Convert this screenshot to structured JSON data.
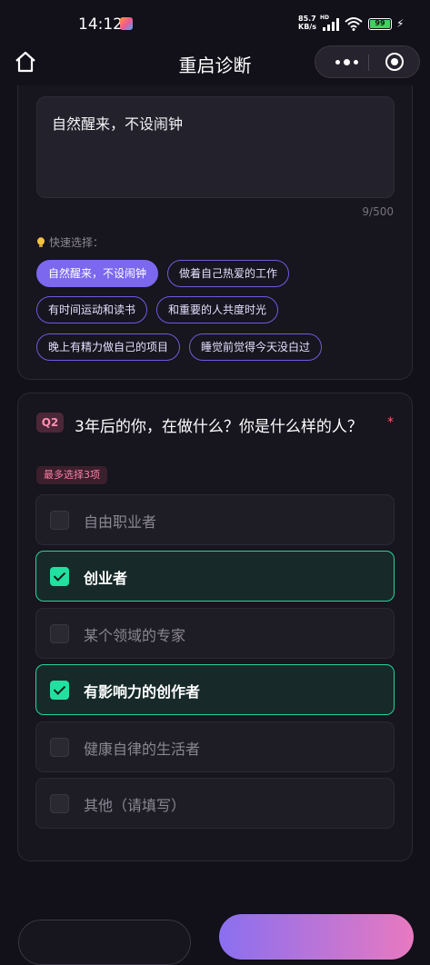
{
  "status_bar": {
    "time": "14:12",
    "net_speed": "85.7",
    "net_unit": "KB/s",
    "hd": "HD",
    "battery": "99",
    "battery_level": 0.99
  },
  "nav": {
    "title": "重启诊断",
    "home_icon": "home-icon",
    "more_icon": "more-dots-icon",
    "close_icon": "close-circle-icon"
  },
  "q1": {
    "answer": "自然醒来，不设闹钟",
    "counter": "9/500",
    "quick_label": "快速选择：",
    "quick_icon": "lightbulb-icon",
    "chips": [
      {
        "label": "自然醒来，不设闹钟",
        "selected": true
      },
      {
        "label": "做着自己热爱的工作",
        "selected": false
      },
      {
        "label": "有时间运动和读书",
        "selected": false
      },
      {
        "label": "和重要的人共度时光",
        "selected": false
      },
      {
        "label": "晚上有精力做自己的项目",
        "selected": false
      },
      {
        "label": "睡觉前觉得今天没白过",
        "selected": false
      }
    ]
  },
  "q2": {
    "badge": "Q2",
    "title": "3年后的你，在做什么？你是什么样的人？",
    "required_mark": "*",
    "limit": "最多选择3项",
    "options": [
      {
        "label": "自由职业者",
        "checked": false
      },
      {
        "label": "创业者",
        "checked": true
      },
      {
        "label": "某个领域的专家",
        "checked": false
      },
      {
        "label": "有影响力的创作者",
        "checked": true
      },
      {
        "label": "健康自律的生活者",
        "checked": false
      },
      {
        "label": "其他（请填写）",
        "checked": false
      }
    ]
  },
  "colors": {
    "background": "#121019",
    "accent_purple": "#7b68ee",
    "check_green": "#22e0a0",
    "badge_pink": "#ff8fb1",
    "required_red": "#ff5c6a"
  }
}
